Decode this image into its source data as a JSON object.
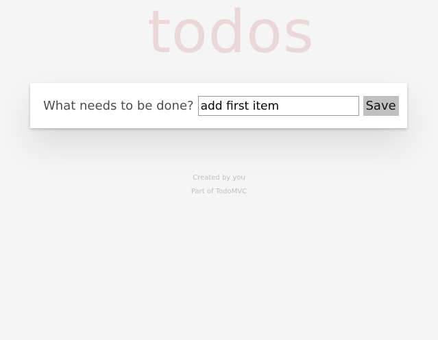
{
  "header": {
    "title": "todos"
  },
  "form": {
    "label": "What needs to be done?",
    "input_value": "add first item",
    "save_label": "Save"
  },
  "footer": {
    "created_by": "Created by you",
    "part_of": "Part of TodoMVC"
  },
  "colors": {
    "background": "#f5f5f5",
    "title": "#ead7d7",
    "card": "#ffffff",
    "button": "#c0c0c0",
    "footer_text": "#bfbfbf"
  }
}
